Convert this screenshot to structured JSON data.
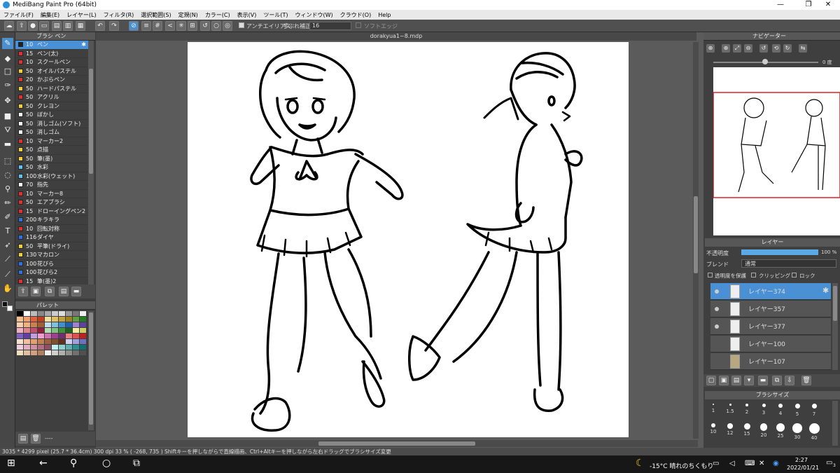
{
  "window": {
    "title": "MediBang Paint Pro (64bit)",
    "min": "—",
    "max": "❐",
    "close": "✕"
  },
  "menu": [
    "ファイル(F)",
    "編集(E)",
    "レイヤー(L)",
    "フィルタ(R)",
    "選択範囲(S)",
    "定規(N)",
    "カラー(C)",
    "表示(V)",
    "ツール(T)",
    "ウィンドウ(W)",
    "クラウド(O)",
    "Help"
  ],
  "toolbar": {
    "antialias": "アンチエイリアス",
    "stabilizer_label": "手ぶれ補正",
    "stabilizer_value": "16",
    "soft_edge": "ソフトエッジ"
  },
  "brush_panel": {
    "title": "ブラシ ペン",
    "items": [
      {
        "size": "10",
        "name": "ペン",
        "color": "#222222"
      },
      {
        "size": "15",
        "name": "ペン(太)",
        "color": "#e03030"
      },
      {
        "size": "10",
        "name": "スクールペン",
        "color": "#e03030"
      },
      {
        "size": "50",
        "name": "オイルパステル",
        "color": "#f0d030"
      },
      {
        "size": "20",
        "name": "かぶらペン",
        "color": "#e03030"
      },
      {
        "size": "50",
        "name": "ハードパステル",
        "color": "#f0d030"
      },
      {
        "size": "50",
        "name": "アクリル",
        "color": "#e03030"
      },
      {
        "size": "50",
        "name": "クレヨン",
        "color": "#f0d030"
      },
      {
        "size": "50",
        "name": "ぼかし",
        "color": "#ffffff"
      },
      {
        "size": "50",
        "name": "消しゴム(ソフト)",
        "color": "#ffffff"
      },
      {
        "size": "50",
        "name": "消しゴム",
        "color": "#ffffff"
      },
      {
        "size": "10",
        "name": "マーカー2",
        "color": "#e03030"
      },
      {
        "size": "50",
        "name": "点描",
        "color": "#f0d030"
      },
      {
        "size": "50",
        "name": "筆(墨)",
        "color": "#f0d030"
      },
      {
        "size": "50",
        "name": "水彩",
        "color": "#60c0f0"
      },
      {
        "size": "100",
        "name": "水彩(ウェット)",
        "color": "#60c0f0"
      },
      {
        "size": "70",
        "name": "指先",
        "color": "#ffffff"
      },
      {
        "size": "10",
        "name": "マーカー8",
        "color": "#e03030"
      },
      {
        "size": "50",
        "name": "エアブラシ",
        "color": "#e03030"
      },
      {
        "size": "15",
        "name": "ドローイングペン2",
        "color": "#e03030"
      },
      {
        "size": "200",
        "name": "キラキラ",
        "color": "#3070e0"
      },
      {
        "size": "10",
        "name": "回転対称",
        "color": "#e03030"
      },
      {
        "size": "116",
        "name": "ダイヤ",
        "color": "#3070e0"
      },
      {
        "size": "50",
        "name": "平筆(ドライ)",
        "color": "#f0d030"
      },
      {
        "size": "130",
        "name": "マカロン",
        "color": "#f0d030"
      },
      {
        "size": "100",
        "name": "花びら",
        "color": "#3070e0"
      },
      {
        "size": "100",
        "name": "花びら2",
        "color": "#3070e0"
      },
      {
        "size": "15",
        "name": "筆(墨)2",
        "color": "#e03030"
      }
    ]
  },
  "palette_panel": {
    "title": "パレット",
    "footer": "----"
  },
  "canvas": {
    "doc_title": "dorakyua1~8.mdp"
  },
  "navigator": {
    "title": "ナビゲーター",
    "angle": "0 度"
  },
  "layer_panel": {
    "title": "レイヤー",
    "opacity_label": "不透明度",
    "opacity_value": "100 %",
    "blend_label": "ブレンド",
    "blend_value": "通常",
    "protect": "透明度を保護",
    "clipping": "クリッピング",
    "lock": "ロック",
    "layers": [
      {
        "name": "レイヤー374"
      },
      {
        "name": "レイヤー357"
      },
      {
        "name": "レイヤー377"
      },
      {
        "name": "レイヤー100"
      },
      {
        "name": "レイヤー107"
      }
    ]
  },
  "brush_size_panel": {
    "title": "ブラシサイズ",
    "row1": [
      "1",
      "1.5",
      "2",
      "3",
      "4",
      "5",
      "7"
    ],
    "row2": [
      "10",
      "12",
      "15",
      "20",
      "25",
      "30",
      "40"
    ]
  },
  "status": {
    "text": "3035 * 4299 pixel   (25.7 * 36.4cm)   300 dpi   33 %   ( -268, 735 )   Shiftキーを押しながらで直線描画、Ctrl+Altキーを押しながら左右ドラッグでブラシサイズ変更"
  },
  "taskbar": {
    "weather": "-15°C 晴れのちくもり",
    "time": "2:27",
    "date": "2022/01/21",
    "notif": "3"
  },
  "colors": {
    "accent": "#4a90d4",
    "panel": "#3f3f3f"
  }
}
